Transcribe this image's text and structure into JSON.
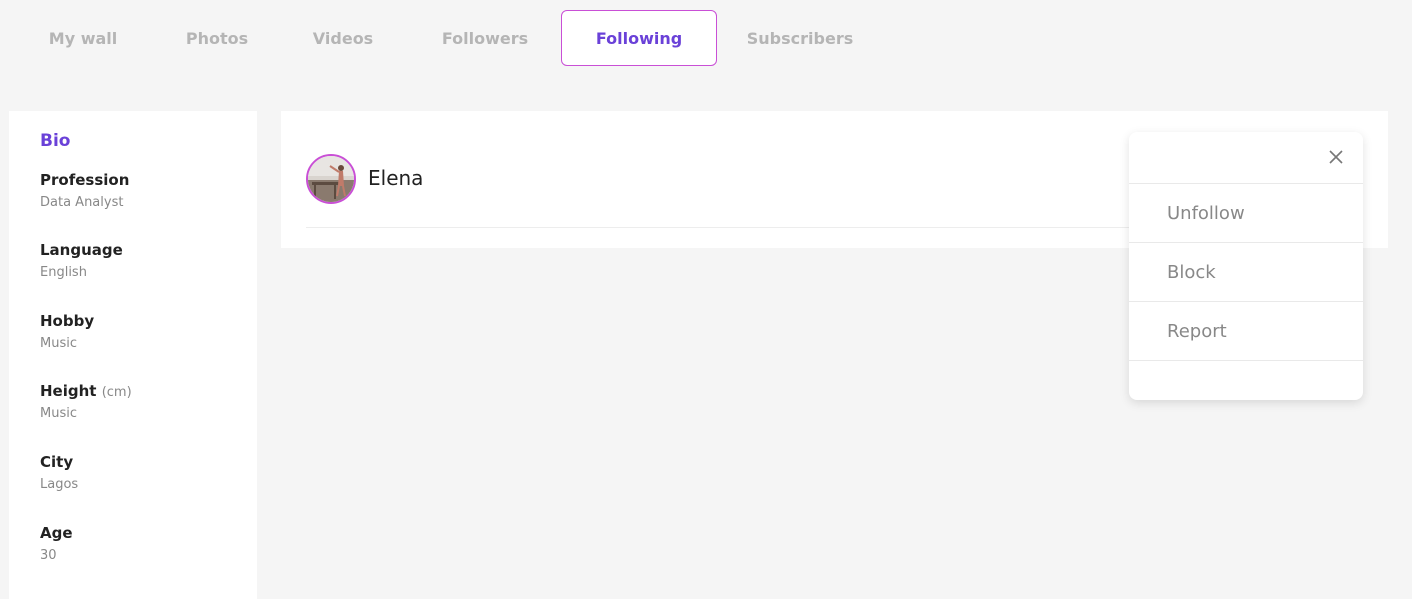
{
  "tabs": [
    {
      "label": "My wall",
      "active": false
    },
    {
      "label": "Photos",
      "active": false
    },
    {
      "label": "Videos",
      "active": false
    },
    {
      "label": "Followers",
      "active": false
    },
    {
      "label": "Following",
      "active": true
    },
    {
      "label": "Subscribers",
      "active": false
    }
  ],
  "bio": {
    "title": "Bio",
    "items": [
      {
        "label": "Profession",
        "value": "Data Analyst"
      },
      {
        "label": "Language",
        "value": "English"
      },
      {
        "label": "Hobby",
        "value": "Music"
      },
      {
        "label": "Height",
        "unit": "(cm)",
        "value": "Music"
      },
      {
        "label": "City",
        "value": "Lagos"
      },
      {
        "label": "Age",
        "value": "30"
      }
    ]
  },
  "following": {
    "users": [
      {
        "name": "Elena"
      }
    ]
  },
  "menu": {
    "close_icon": "close-icon",
    "items": [
      "Unfollow",
      "Block",
      "Report"
    ]
  },
  "colors": {
    "accent": "#6a41d8",
    "accent_border": "#c94fd6",
    "muted": "#b5b5b5"
  }
}
